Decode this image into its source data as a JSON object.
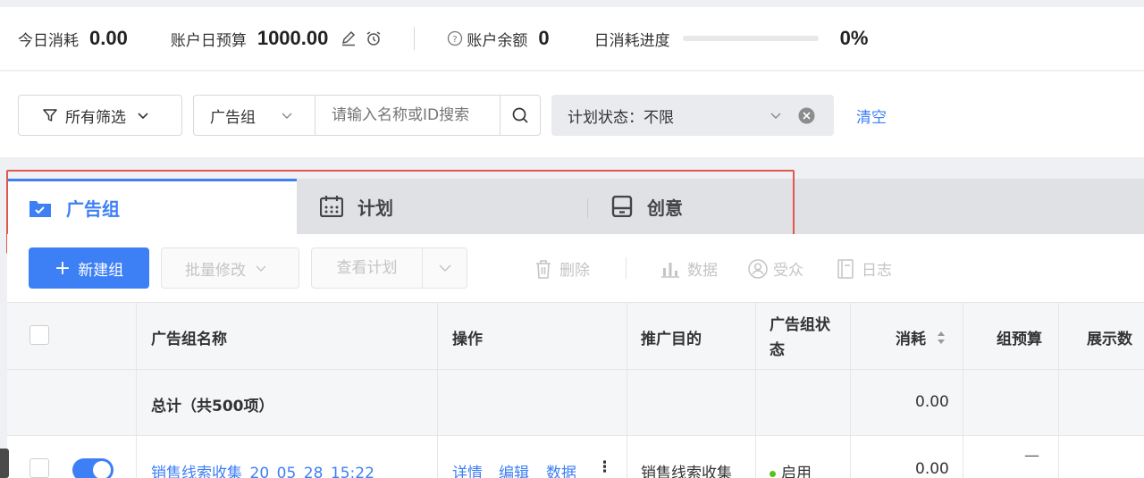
{
  "stats": {
    "today_label": "今日消耗",
    "today_value": "0.00",
    "budget_label": "账户日预算",
    "budget_value": "1000.00",
    "balance_label": "账户余额",
    "balance_value": "0",
    "progress_label": "日消耗进度",
    "progress_percent": 0,
    "progress_value": "0%"
  },
  "filters": {
    "all_filters_label": "所有筛选",
    "scope_select": "广告组",
    "search_placeholder": "请输入名称或ID搜索",
    "plan_status": "计划状态：不限",
    "clear_label": "清空"
  },
  "tabs": [
    {
      "label": "广告组",
      "icon": "folder-check-icon"
    },
    {
      "label": "计划",
      "icon": "calendar-icon"
    },
    {
      "label": "创意",
      "icon": "creative-icon"
    }
  ],
  "toolbar": {
    "new_group": "新建组",
    "batch_edit": "批量修改",
    "view_plan": "查看计划",
    "delete": "删除",
    "data": "数据",
    "audience": "受众",
    "log": "日志"
  },
  "table": {
    "columns": [
      "广告组名称",
      "操作",
      "推广目的",
      "广告组状态",
      "消耗",
      "组预算",
      "展示数"
    ],
    "summary_label": "总计（共500项）",
    "summary_spend": "0.00",
    "rows": [
      {
        "name": "销售线索收集_20_05_28_15:22",
        "actions": [
          "详情",
          "编辑",
          "数据"
        ],
        "purpose": "销售线索收集",
        "status": "启用",
        "spend": "0.00",
        "budget": "—"
      }
    ]
  },
  "colors": {
    "accent": "#3d7ff5",
    "highlight_box": "#e0574f",
    "status_on": "#52c41a"
  }
}
